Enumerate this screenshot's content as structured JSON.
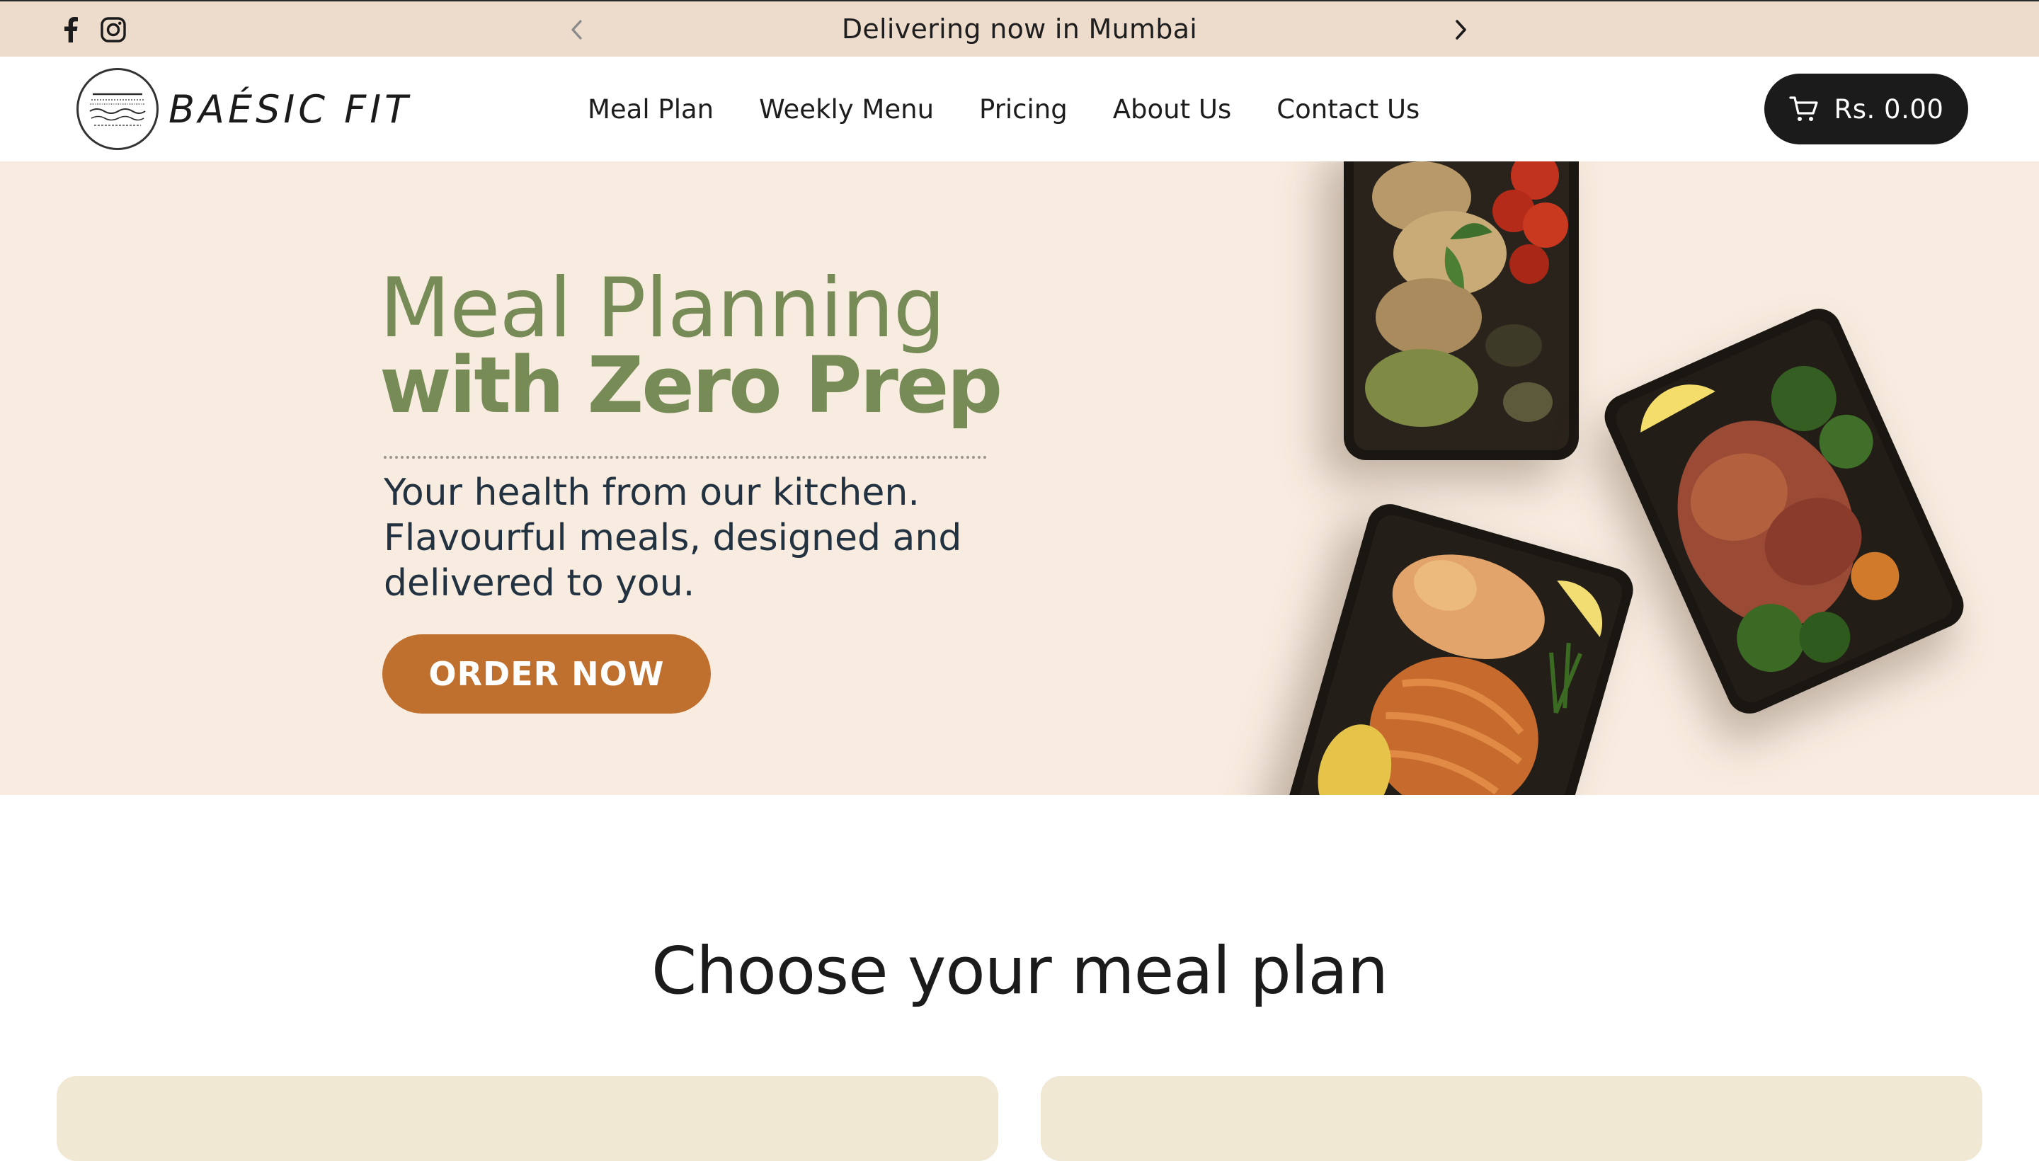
{
  "announcement": {
    "text": "Delivering now in Mumbai"
  },
  "social": {
    "facebook_icon": "facebook-icon",
    "instagram_icon": "instagram-icon"
  },
  "brand": {
    "name": "BAÉSIC FIT"
  },
  "nav": {
    "items": [
      {
        "label": "Meal Plan"
      },
      {
        "label": "Weekly Menu"
      },
      {
        "label": "Pricing"
      },
      {
        "label": "About Us"
      },
      {
        "label": "Contact Us"
      }
    ]
  },
  "cart": {
    "label": "Rs. 0.00",
    "icon": "cart-icon"
  },
  "hero": {
    "title_line1": "Meal Planning",
    "title_line2": "with Zero Prep",
    "subtitle": "Your health from our kitchen. Flavourful meals, designed and delivered to you.",
    "cta_label": "ORDER NOW"
  },
  "plans": {
    "heading": "Choose your meal plan"
  },
  "colors": {
    "announcement_bg": "#eddccb",
    "hero_bg": "#f8ece0",
    "hero_title": "#778b57",
    "cta_bg": "#c0702e",
    "cart_bg": "#1b1b1b",
    "plan_card_bg": "#f1e8d4"
  }
}
